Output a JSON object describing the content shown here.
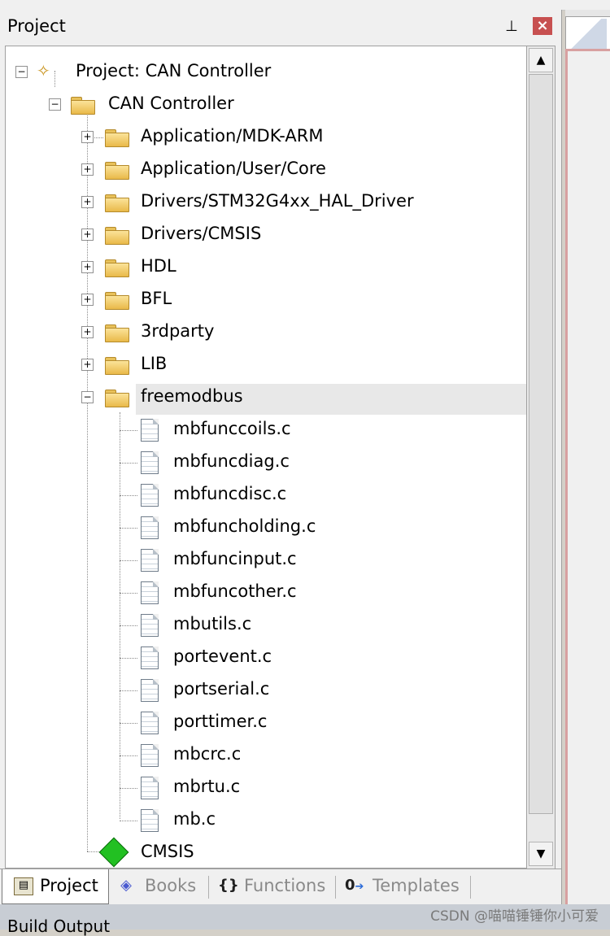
{
  "panel": {
    "title": "Project",
    "pin_icon": "pin-icon",
    "close_icon": "close-icon"
  },
  "tree": {
    "root": "Project: CAN Controller",
    "target": "CAN Controller",
    "groups": [
      {
        "label": "Application/MDK-ARM",
        "expanded": false
      },
      {
        "label": "Application/User/Core",
        "expanded": false
      },
      {
        "label": "Drivers/STM32G4xx_HAL_Driver",
        "expanded": false
      },
      {
        "label": "Drivers/CMSIS",
        "expanded": false
      },
      {
        "label": "HDL",
        "expanded": false
      },
      {
        "label": "BFL",
        "expanded": false
      },
      {
        "label": "3rdparty",
        "expanded": false
      },
      {
        "label": "LIB",
        "expanded": false
      },
      {
        "label": "freemodbus",
        "expanded": true
      }
    ],
    "files": [
      "mbfunccoils.c",
      "mbfuncdiag.c",
      "mbfuncdisc.c",
      "mbfuncholding.c",
      "mbfuncinput.c",
      "mbfuncother.c",
      "mbutils.c",
      "portevent.c",
      "portserial.c",
      "porttimer.c",
      "mbcrc.c",
      "mbrtu.c",
      "mb.c"
    ],
    "cmsis": "CMSIS"
  },
  "tabs": [
    {
      "label": "Project",
      "active": true
    },
    {
      "label": "Books",
      "active": false
    },
    {
      "label": "Functions",
      "active": false
    },
    {
      "label": "Templates",
      "active": false
    }
  ],
  "bottom": {
    "title": "Build Output"
  },
  "watermark": "CSDN @喵喵锤锤你小可爱",
  "colors": {
    "close": "#c75050",
    "selection": "#e8e8e8",
    "folder": "#f2cc64"
  }
}
